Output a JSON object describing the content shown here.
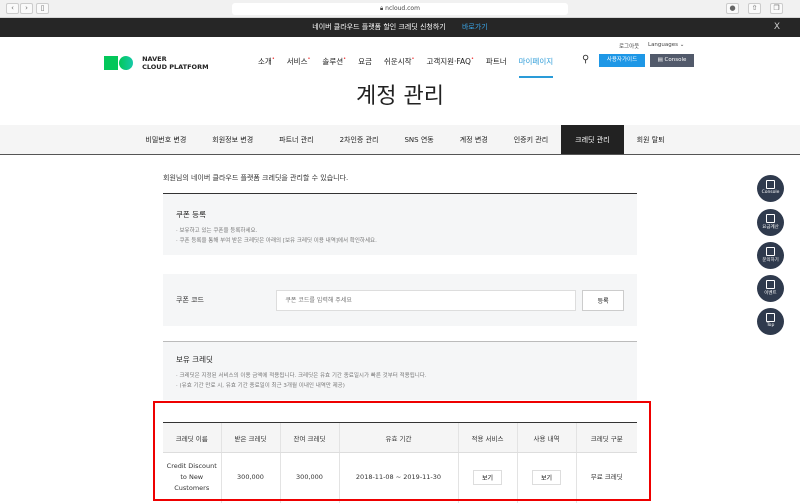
{
  "browser": {
    "url": "ncloud.com"
  },
  "banner": {
    "text": "네이버 클라우드 플랫폼 할인 크레딧 신청하기",
    "link": "바로가기",
    "close": "X"
  },
  "header": {
    "logo_line1": "NAVER",
    "logo_line2": "CLOUD PLATFORM",
    "logout": "로그아웃",
    "languages": "Languages",
    "nav": [
      "소개",
      "서비스",
      "솔루션",
      "요금",
      "쉬운시작",
      "고객지원·FAQ",
      "파트너",
      "마이페이지"
    ],
    "guide_button": "사용자가이드",
    "console_button": "Console"
  },
  "page_title": "계정 관리",
  "tabs": [
    "비밀번호 변경",
    "회원정보 변경",
    "파트너 관리",
    "2차인증 관리",
    "SNS 연동",
    "계정 변경",
    "인증키 관리",
    "크레딧 관리",
    "회원 탈퇴"
  ],
  "intro": "회원님의 네이버 클라우드 플랫폼 크레딧을 관리할 수 있습니다.",
  "coupon": {
    "title": "쿠폰 등록",
    "notes": [
      "보유하고 있는 쿠폰을 등록하세요.",
      "쿠폰 등록을 통해 부여 받은 크레딧은 아래의 [보유 크레딧 이용 내역]에서 확인하세요."
    ],
    "label": "쿠폰 코드",
    "placeholder": "쿠폰 코드를 입력해 주세요",
    "register": "등록"
  },
  "held": {
    "title": "보유 크레딧",
    "notes": [
      "크레딧은 지정된 서비스의 이용 금액에 적용됩니다. 크레딧은 유효 기간 종료일시가 빠른 것부터 적용됩니다.",
      "(유효 기간 만료 시, 유효 기간 종료일이 최근 3개월 이내인 내역만 제공)"
    ]
  },
  "table": {
    "headers": [
      "크레딧 이름",
      "받은 크레딧",
      "잔여 크레딧",
      "유효 기간",
      "적용 서비스",
      "사용 내역",
      "크레딧 구분"
    ],
    "rows": [
      {
        "name": "Credit Discount to New Customers",
        "received": "300,000",
        "remaining": "300,000",
        "period": "2018-11-08 ~ 2019-11-30",
        "service": "보기",
        "history": "보기",
        "type": "무료 크레딧"
      }
    ]
  },
  "floating": [
    "Console",
    "요금계산",
    "문의하기",
    "이벤트",
    "Top"
  ]
}
